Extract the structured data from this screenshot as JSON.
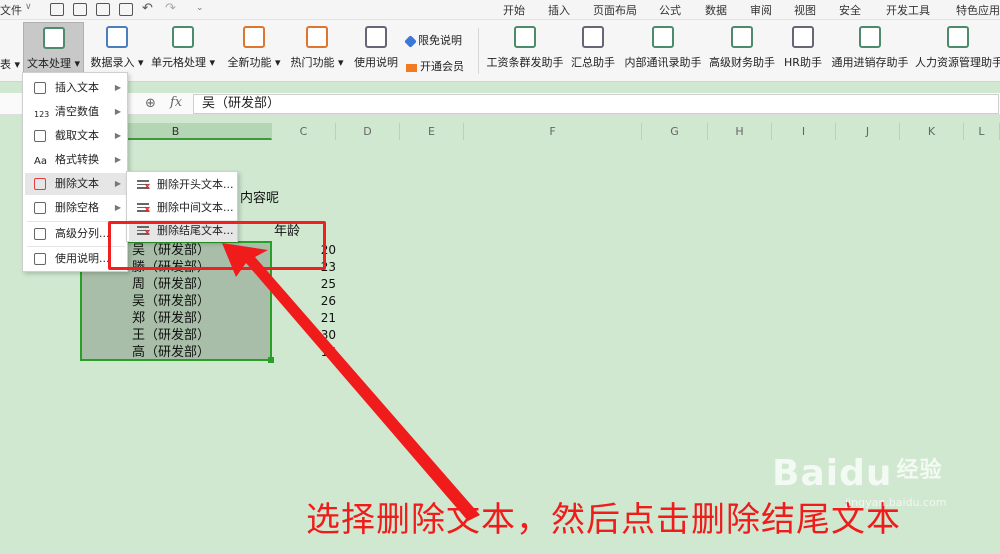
{
  "menubar": {
    "file_label": "文件",
    "tabs": [
      "开始",
      "插入",
      "页面布局",
      "公式",
      "数据",
      "审阅",
      "视图",
      "安全",
      "开发工具",
      "特色应用"
    ]
  },
  "ribbon": {
    "cut_left_label": "表",
    "buttons": [
      {
        "label": "文本处理",
        "icon": "text-process-icon"
      },
      {
        "label": "数据录入",
        "icon": "data-entry-icon"
      },
      {
        "label": "单元格处理",
        "icon": "cell-process-icon"
      },
      {
        "label": "全新功能",
        "icon": "new-feature-icon"
      },
      {
        "label": "热门功能",
        "icon": "hot-feature-icon"
      },
      {
        "label": "使用说明",
        "icon": "help-doc-icon"
      }
    ],
    "small_buttons": [
      {
        "label": "限免说明",
        "icon": "tag-icon"
      },
      {
        "label": "开通会员",
        "icon": "crown-icon"
      }
    ],
    "assistants": [
      "工资条群发助手",
      "汇总助手",
      "内部通讯录助手",
      "高级财务助手",
      "HR助手",
      "通用进销存助手",
      "人力资源管理助手"
    ]
  },
  "formula_bar": {
    "fx_label": "fx",
    "value": "吴（研发部）"
  },
  "sheet": {
    "columns": [
      "B",
      "C",
      "D",
      "E",
      "F",
      "G",
      "H",
      "I",
      "J",
      "K",
      "L"
    ],
    "partial_text": "内容呢",
    "header_age": "年龄",
    "names": [
      "吴（研发部）",
      "滕（研发部）",
      "周（研发部）",
      "吴（研发部）",
      "郑（研发部）",
      "王（研发部）",
      "高（研发部）"
    ],
    "ages": [
      "20",
      "23",
      "25",
      "26",
      "21",
      "30",
      "16"
    ]
  },
  "dropdown": {
    "items": [
      {
        "label": "插入文本",
        "icon": "insert-text-icon"
      },
      {
        "label": "清空数值",
        "icon": "clear-number-icon"
      },
      {
        "label": "截取文本",
        "icon": "extract-text-icon"
      },
      {
        "label": "格式转换",
        "icon": "format-convert-icon"
      },
      {
        "label": "删除文本",
        "icon": "delete-text-icon"
      },
      {
        "label": "删除空格",
        "icon": "delete-space-icon"
      },
      {
        "label": "高级分列...",
        "icon": "advanced-split-icon"
      },
      {
        "label": "使用说明...",
        "icon": "help-icon"
      }
    ]
  },
  "submenu": {
    "items": [
      {
        "label": "删除开头文本..."
      },
      {
        "label": "删除中间文本..."
      },
      {
        "label": "删除结尾文本..."
      }
    ]
  },
  "annotation": {
    "caption": "选择删除文本，然后点击删除结尾文本",
    "color": "#f01c1c"
  },
  "watermark": {
    "brand": "Baidu",
    "cn": "经验",
    "url": "jingyan.baidu.com"
  }
}
